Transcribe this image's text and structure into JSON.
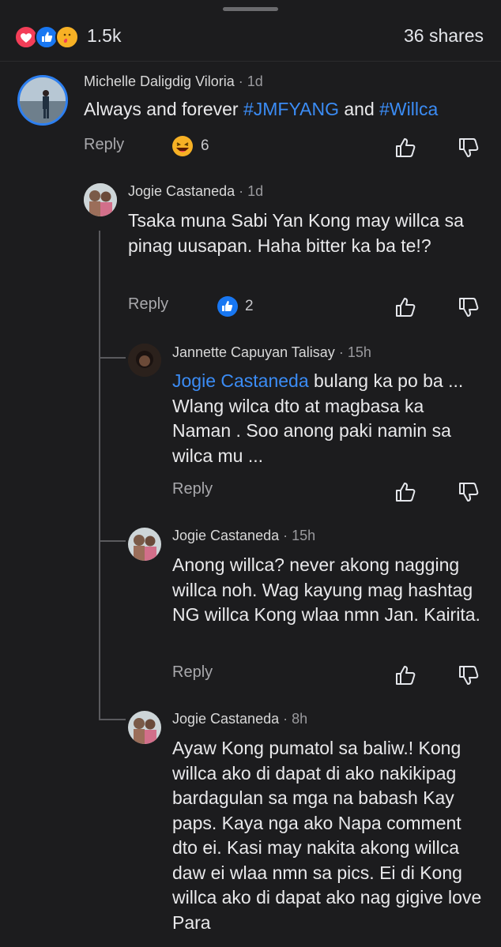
{
  "post_stats": {
    "reactions_count": "1.5k",
    "shares": "36 shares",
    "reaction_icons": [
      "heart-icon",
      "like-icon",
      "care-icon"
    ]
  },
  "comments": [
    {
      "name": "Michelle Daligdig Viloria",
      "time": "1d",
      "text_parts": [
        "Always and forever ",
        "#JMFYANG",
        " and ",
        "#Willca"
      ],
      "reply": "Reply",
      "reaction": {
        "icon": "haha-icon",
        "count": "6"
      }
    },
    {
      "name": "Jogie Castaneda",
      "time": "1d",
      "text": "Tsaka muna Sabi Yan Kong may willca sa pinag uusapan. Haha bitter ka ba te!?",
      "reply": "Reply",
      "reaction": {
        "icon": "like-icon",
        "count": "2"
      }
    },
    {
      "name": "Jannette Capuyan Talisay",
      "time": "15h",
      "mention": "Jogie Castaneda",
      "text": " bulang ka po ba ... Wlang wilca dto at magbasa ka Naman . Soo anong paki namin sa wilca mu ...",
      "reply": "Reply"
    },
    {
      "name": "Jogie Castaneda",
      "time": "15h",
      "text": "Anong willca? never akong nagging willca noh. Wag kayung mag hashtag NG willca Kong wlaa nmn Jan. Kairita.",
      "reply": "Reply"
    },
    {
      "name": "Jogie Castaneda",
      "time": "8h",
      "text": "Ayaw Kong pumatol sa baliw.! Kong willca ako di dapat di ako nakikipag bardagulan sa mga na babash Kay paps. Kaya nga ako Napa comment dto ei. Kasi may nakita akong willca daw ei wlaa nmn sa pics. Ei di Kong willca ako di dapat ako nag gigive love Para"
    }
  ],
  "colors": {
    "background": "#1c1c1e",
    "link": "#3b8cf5",
    "like_blue": "#1877f2",
    "heart_red": "#f33e58"
  }
}
